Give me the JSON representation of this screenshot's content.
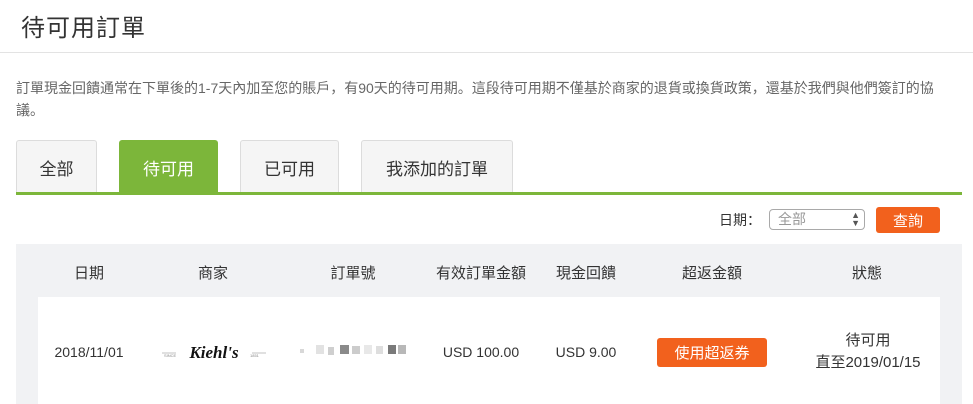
{
  "page": {
    "title": "待可用訂單"
  },
  "notice": "訂單現金回饋通常在下單後的1-7天內加至您的賬戶，有90天的待可用期。這段待可用期不僅基於商家的退貨或換貨政策，還基於我們與他們簽訂的協議。",
  "tabs": [
    {
      "label": "全部",
      "active": false
    },
    {
      "label": "待可用",
      "active": true
    },
    {
      "label": "已可用",
      "active": false
    },
    {
      "label": "我添加的訂單",
      "active": false
    }
  ],
  "filter": {
    "label": "日期：",
    "selected": "全部",
    "query_label": "查詢"
  },
  "table": {
    "headers": [
      "日期",
      "商家",
      "訂單號",
      "有效訂單金額",
      "現金回饋",
      "超返金額",
      "狀態"
    ],
    "rows": [
      {
        "date": "2018/11/01",
        "merchant_logo_text": "Kiehl's",
        "merchant_logo_small_left": "SINCE",
        "merchant_logo_small_right": "1851",
        "order_amount": "USD 100.00",
        "cashback": "USD 9.00",
        "bonus_button": "使用超返券",
        "status": "待可用",
        "status_until": "直至2019/01/15"
      }
    ]
  },
  "colors": {
    "accent_green": "#7cb63a",
    "action_orange": "#f2611d"
  }
}
